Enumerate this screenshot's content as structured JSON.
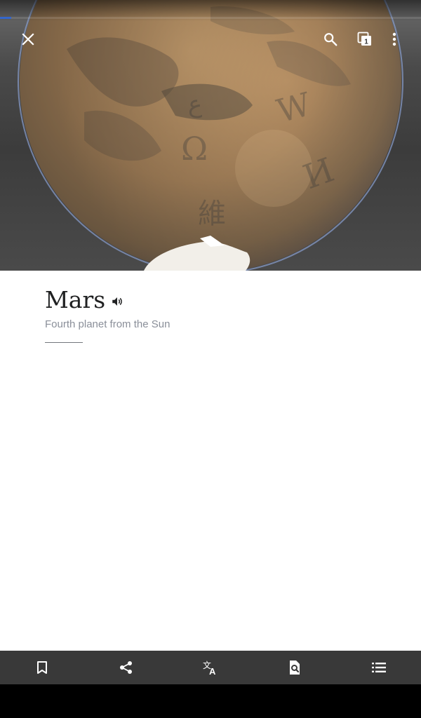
{
  "article": {
    "title": "Mars",
    "description": "Fourth planet from the Sun"
  },
  "load_progress": 0.027,
  "tabs": {
    "count": "1"
  },
  "icons": {
    "close": "close-icon",
    "search": "search-icon",
    "tabs": "tabs-icon",
    "overflow": "more-vert-icon",
    "audio": "volume-icon",
    "bookmark": "bookmark-icon",
    "share": "share-icon",
    "translate": "translate-icon",
    "find": "find-in-page-icon",
    "contents": "contents-list-icon"
  },
  "colors": {
    "progress": "#3366cc",
    "bottom_bar": "#393939",
    "title": "#202122",
    "description": "#8a8f99"
  }
}
